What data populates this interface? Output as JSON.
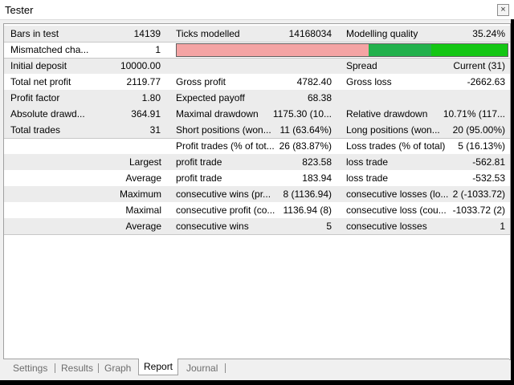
{
  "window": {
    "title": "Tester",
    "close_glyph": "×"
  },
  "rows": [
    {
      "c1": "Bars in test",
      "c2": "14139",
      "c3": "Ticks modelled",
      "c4": "14168034",
      "c5": "Modelling quality",
      "c6": "35.24%"
    },
    {
      "c1": "Mismatched cha...",
      "c2": "1"
    },
    {
      "c1": "Initial deposit",
      "c2": "10000.00",
      "c5": "Spread",
      "c6": "Current (31)"
    },
    {
      "c1": "Total net profit",
      "c2": "2119.77",
      "c3": "Gross profit",
      "c4": "4782.40",
      "c5": "Gross loss",
      "c6": "-2662.63"
    },
    {
      "c1": "Profit factor",
      "c2": "1.80",
      "c3": "Expected payoff",
      "c4": "68.38"
    },
    {
      "c1": "Absolute drawd...",
      "c2": "364.91",
      "c3": "Maximal drawdown",
      "c4": "1175.30 (10...",
      "c5": "Relative drawdown",
      "c6": "10.71% (117..."
    },
    {
      "c1": "Total trades",
      "c2": "31",
      "c3": "Short positions (won...",
      "c4": "11 (63.64%)",
      "c5": "Long positions (won...",
      "c6": "20 (95.00%)"
    },
    {
      "c3": "Profit trades (% of tot...",
      "c4": "26 (83.87%)",
      "c5": "Loss trades (% of total)",
      "c6": "5 (16.13%)"
    },
    {
      "c1r": "Largest",
      "c3": "profit trade",
      "c4": "823.58",
      "c5": "loss trade",
      "c6": "-562.81"
    },
    {
      "c1r": "Average",
      "c3": "profit trade",
      "c4": "183.94",
      "c5": "loss trade",
      "c6": "-532.53"
    },
    {
      "c1r": "Maximum",
      "c3": "consecutive wins (pr...",
      "c4": "8 (1136.94)",
      "c5": "consecutive losses (lo...",
      "c6": "2 (-1033.72)"
    },
    {
      "c1r": "Maximal",
      "c3": "consecutive profit (co...",
      "c4": "1136.94 (8)",
      "c5": "consecutive loss (cou...",
      "c6": "-1033.72 (2)"
    },
    {
      "c1r": "Average",
      "c3": "consecutive wins",
      "c4": "5",
      "c5": "consecutive losses",
      "c6": "1"
    }
  ],
  "quality_bar": {
    "segments": [
      {
        "name": "mismatch",
        "fraction": 0.58,
        "color": "#f4a4a4"
      },
      {
        "name": "quality-dark",
        "fraction": 0.19,
        "color": "#22b14c"
      },
      {
        "name": "quality-light",
        "fraction": 0.23,
        "color": "#13c613"
      }
    ]
  },
  "tabs": [
    "Settings",
    "Results",
    "Graph",
    "Report",
    "Journal"
  ],
  "active_tab": "Report"
}
